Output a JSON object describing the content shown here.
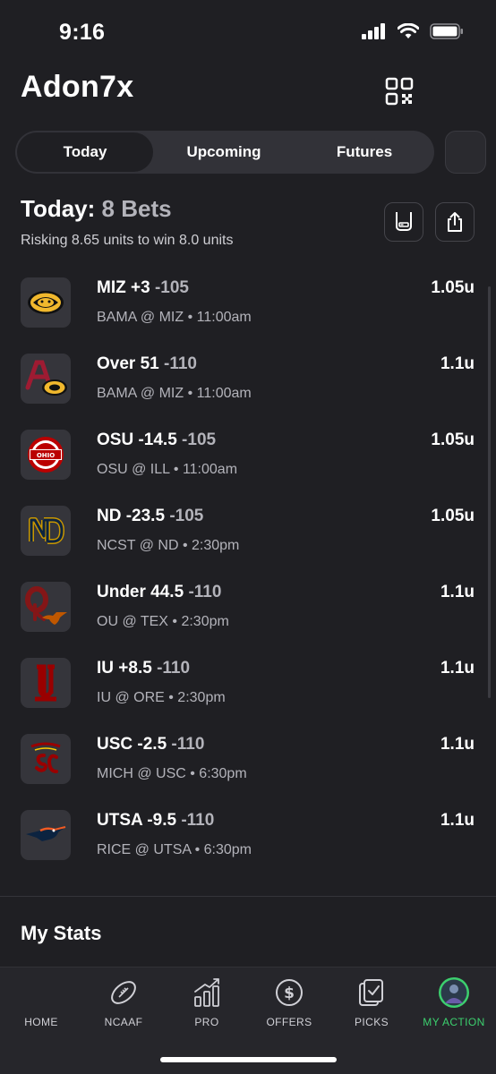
{
  "status": {
    "time": "9:16"
  },
  "header": {
    "username": "Adon7x"
  },
  "tabs": [
    {
      "label": "Today"
    },
    {
      "label": "Upcoming"
    },
    {
      "label": "Futures"
    }
  ],
  "summary": {
    "title": "Today:",
    "count": "8 Bets",
    "risk_text": "Risking 8.65 units to win 8.0 units"
  },
  "bets": [
    {
      "pick": "MIZ +3",
      "odds": "-105",
      "game": "BAMA @ MIZ • 11:00am",
      "units": "1.05u",
      "logo": "mizzou-tiger-logo"
    },
    {
      "pick": "Over 51",
      "odds": "-110",
      "game": "BAMA @ MIZ • 11:00am",
      "units": "1.1u",
      "logo": "alabama-mizzou-logo"
    },
    {
      "pick": "OSU -14.5",
      "odds": "-105",
      "game": "OSU @ ILL • 11:00am",
      "units": "1.05u",
      "logo": "ohio-state-logo"
    },
    {
      "pick": "ND -23.5",
      "odds": "-105",
      "game": "NCST @ ND • 2:30pm",
      "units": "1.05u",
      "logo": "notre-dame-logo"
    },
    {
      "pick": "Under 44.5",
      "odds": "-110",
      "game": "OU @ TEX • 2:30pm",
      "units": "1.1u",
      "logo": "oklahoma-texas-logo"
    },
    {
      "pick": "IU +8.5",
      "odds": "-110",
      "game": "IU @ ORE • 2:30pm",
      "units": "1.1u",
      "logo": "indiana-logo"
    },
    {
      "pick": "USC -2.5",
      "odds": "-110",
      "game": "MICH @ USC • 6:30pm",
      "units": "1.1u",
      "logo": "usc-trojans-logo"
    },
    {
      "pick": "UTSA -9.5",
      "odds": "-110",
      "game": "RICE @ UTSA • 6:30pm",
      "units": "1.1u",
      "logo": "utsa-roadrunner-logo"
    }
  ],
  "sections": {
    "my_stats": "My Stats"
  },
  "nav": [
    {
      "label": "HOME",
      "icon": "home-icon"
    },
    {
      "label": "NCAAF",
      "icon": "football-icon"
    },
    {
      "label": "PRO",
      "icon": "chart-icon"
    },
    {
      "label": "OFFERS",
      "icon": "dollar-icon"
    },
    {
      "label": "PICKS",
      "icon": "picks-icon"
    },
    {
      "label": "MY ACTION",
      "icon": "avatar-icon"
    }
  ],
  "colors": {
    "background": "#1f1f23",
    "active_nav": "#3ccf6e",
    "muted_text": "#b3b3ba"
  }
}
